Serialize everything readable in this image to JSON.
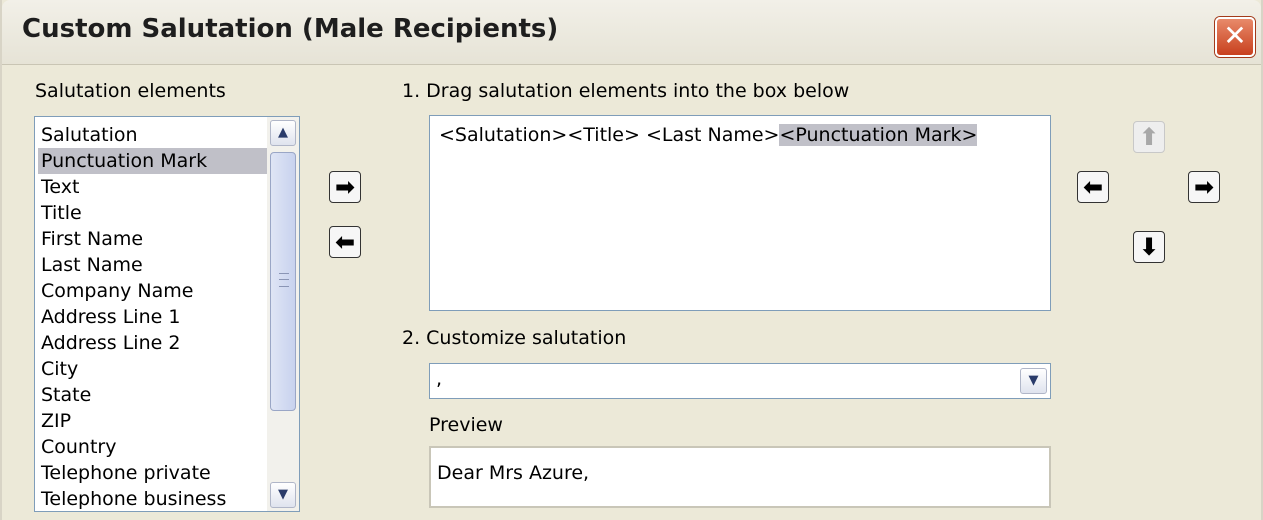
{
  "window": {
    "title": "Custom Salutation (Male Recipients)",
    "close_glyph": "✕"
  },
  "elements_panel": {
    "label": "Salutation elements",
    "items": [
      "Salutation",
      "Punctuation Mark",
      "Text",
      "Title",
      "First Name",
      "Last Name",
      "Company Name",
      "Address Line 1",
      "Address Line 2",
      "City",
      "State",
      "ZIP",
      "Country",
      "Telephone private",
      "Telephone business"
    ],
    "selected_index": 1,
    "scroll_up_glyph": "▲",
    "scroll_down_glyph": "▼"
  },
  "transfer": {
    "add_glyph": "➡",
    "remove_glyph": "⬅"
  },
  "step1": {
    "label": "1. Drag salutation elements into the box below",
    "text_plain": "<Salutation><Title> <Last Name>",
    "text_selected": "<Punctuation Mark>"
  },
  "move_buttons": {
    "up_glyph": "⬆",
    "left_glyph": "⬅",
    "right_glyph": "➡",
    "down_glyph": "⬇",
    "up_enabled": false
  },
  "step2": {
    "label": "2. Customize salutation",
    "value": ",",
    "dropdown_glyph": "▼"
  },
  "preview": {
    "label": "Preview",
    "text": "Dear Mrs Azure,"
  },
  "colors": {
    "dialog_bg": "#ece9d8",
    "selection": "#c0c0c8",
    "field_border": "#7f9db9",
    "close_button": "#c8401e"
  }
}
